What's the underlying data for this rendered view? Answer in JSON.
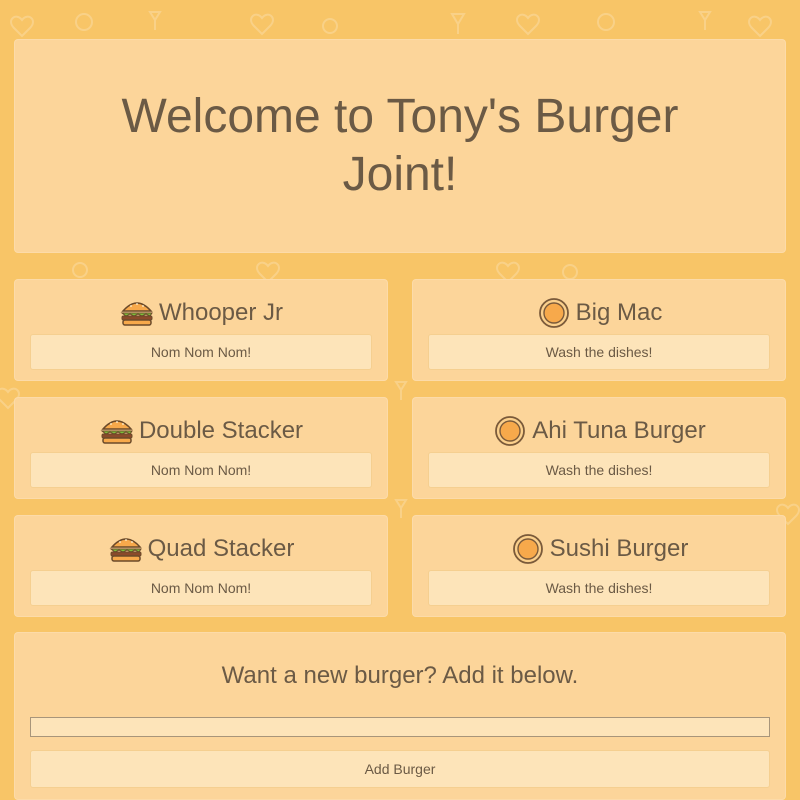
{
  "hero": {
    "title": "Welcome to Tony's Burger Joint!"
  },
  "colors": {
    "background": "#f8c567",
    "panel": "#fcd59a",
    "button": "#fde4b9",
    "text": "#6b5a45",
    "plate_fill": "#f7a94b",
    "plate_ring": "#7a5a3a"
  },
  "uneaten_burgers": [
    {
      "name": "Whooper Jr",
      "icon": "burger-icon",
      "action_label": "Nom Nom Nom!"
    },
    {
      "name": "Double Stacker",
      "icon": "burger-icon",
      "action_label": "Nom Nom Nom!"
    },
    {
      "name": "Quad Stacker",
      "icon": "burger-icon",
      "action_label": "Nom Nom Nom!"
    }
  ],
  "eaten_burgers": [
    {
      "name": "Big Mac",
      "icon": "empty-plate-icon",
      "action_label": "Wash the dishes!"
    },
    {
      "name": "Ahi Tuna Burger",
      "icon": "empty-plate-icon",
      "action_label": "Wash the dishes!"
    },
    {
      "name": "Sushi Burger",
      "icon": "empty-plate-icon",
      "action_label": "Wash the dishes!"
    }
  ],
  "add_form": {
    "prompt": "Want a new burger? Add it below.",
    "input_value": "",
    "button_label": "Add Burger"
  }
}
